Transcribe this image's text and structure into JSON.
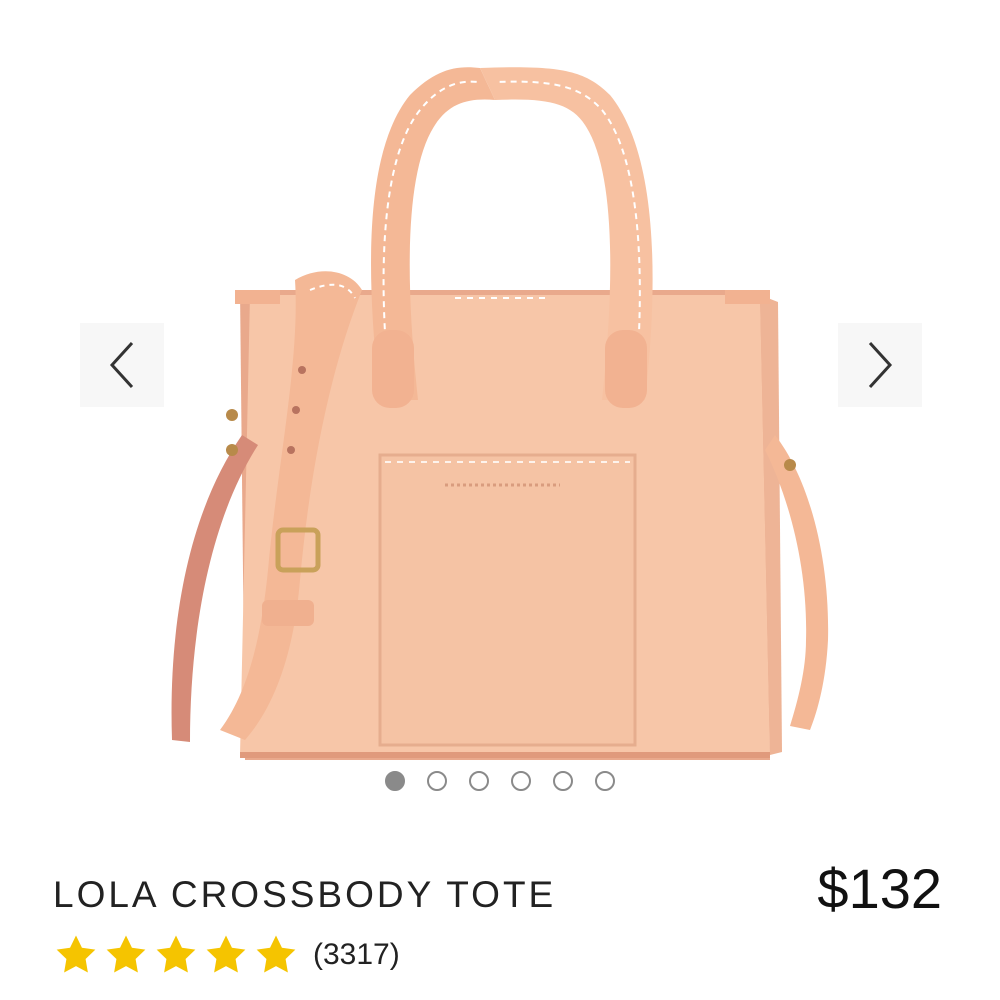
{
  "product": {
    "title": "LOLA CROSSBODY TOTE",
    "price": "$132",
    "rating": 5,
    "rating_max": 5,
    "review_count": "(3317)",
    "color": "#f7c6a8"
  },
  "carousel": {
    "image_count": 6,
    "active_index": 0,
    "prev_icon": "chevron-left-icon",
    "next_icon": "chevron-right-icon"
  },
  "colors": {
    "star": "#f5c400",
    "dot": "#8a8a8a"
  }
}
